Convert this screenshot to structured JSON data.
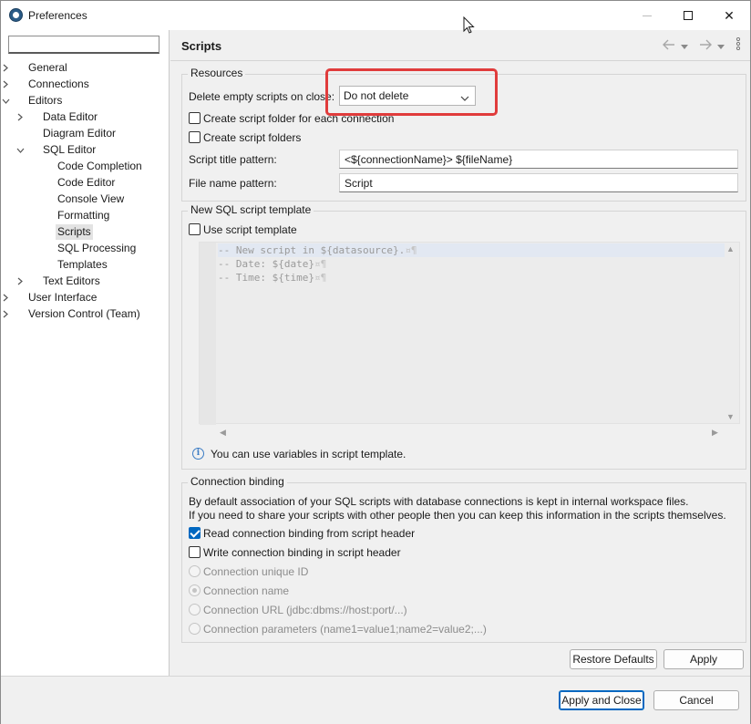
{
  "window": {
    "title": "Preferences",
    "close_glyph": "✕"
  },
  "sidebar": {
    "filter_value": "",
    "items": [
      {
        "label": "General",
        "level": 0,
        "twisty": "collapsed"
      },
      {
        "label": "Connections",
        "level": 0,
        "twisty": "collapsed"
      },
      {
        "label": "Editors",
        "level": 0,
        "twisty": "expanded"
      },
      {
        "label": "Data Editor",
        "level": 1,
        "twisty": "collapsed"
      },
      {
        "label": "Diagram Editor",
        "level": 1,
        "twisty": "none"
      },
      {
        "label": "SQL Editor",
        "level": 1,
        "twisty": "expanded"
      },
      {
        "label": "Code Completion",
        "level": 2,
        "twisty": "none"
      },
      {
        "label": "Code Editor",
        "level": 2,
        "twisty": "none"
      },
      {
        "label": "Console View",
        "level": 2,
        "twisty": "none"
      },
      {
        "label": "Formatting",
        "level": 2,
        "twisty": "none"
      },
      {
        "label": "Scripts",
        "level": 2,
        "twisty": "none",
        "selected": true
      },
      {
        "label": "SQL Processing",
        "level": 2,
        "twisty": "none"
      },
      {
        "label": "Templates",
        "level": 2,
        "twisty": "none"
      },
      {
        "label": "Text Editors",
        "level": 1,
        "twisty": "collapsed"
      },
      {
        "label": "User Interface",
        "level": 0,
        "twisty": "collapsed"
      },
      {
        "label": "Version Control (Team)",
        "level": 0,
        "twisty": "collapsed"
      }
    ]
  },
  "page": {
    "title": "Scripts",
    "nav": {
      "back_icon": "back-arrow-icon",
      "forward_icon": "forward-arrow-icon",
      "menu_icon": "vertical-dots-icon"
    }
  },
  "resources": {
    "title": "Resources",
    "delete_label": "Delete empty scripts on close:",
    "delete_value": "Do not delete",
    "create_folder_per_connection": {
      "label": "Create script folder for each connection",
      "checked": false
    },
    "create_folders": {
      "label": "Create script folders",
      "checked": false
    },
    "title_pattern_label": "Script title pattern:",
    "title_pattern_value": "<${connectionName}> ${fileName}",
    "file_name_pattern_label": "File name pattern:",
    "file_name_pattern_value": "Script"
  },
  "template": {
    "title": "New SQL script template",
    "use_template": {
      "label": "Use script template",
      "checked": false
    },
    "lines": [
      "-- New script in ${datasource}.",
      "-- Date: ${date}",
      "-- Time: ${time}"
    ],
    "line_end_marker": "¤¶",
    "info": "You can use variables in script template."
  },
  "binding": {
    "title": "Connection binding",
    "desc1": "By default association of your SQL scripts with database connections is kept in internal workspace files.",
    "desc2": "If you need to share your scripts with other people then you can keep this information in the scripts themselves.",
    "read_header": {
      "label": "Read connection binding from script header",
      "checked": true
    },
    "write_header": {
      "label": "Write connection binding in script header",
      "checked": false
    },
    "options": [
      {
        "label": "Connection unique ID",
        "selected": false
      },
      {
        "label": "Connection name",
        "selected": true
      },
      {
        "label": "Connection URL (jdbc:dbms://host:port/...)",
        "selected": false
      },
      {
        "label": "Connection parameters (name1=value1;name2=value2;...)",
        "selected": false
      }
    ]
  },
  "buttons": {
    "restore": "Restore Defaults",
    "apply": "Apply",
    "apply_close": "Apply and Close",
    "cancel": "Cancel"
  },
  "colors": {
    "highlight_box": "#e03c3c",
    "accent": "#0067c0"
  }
}
